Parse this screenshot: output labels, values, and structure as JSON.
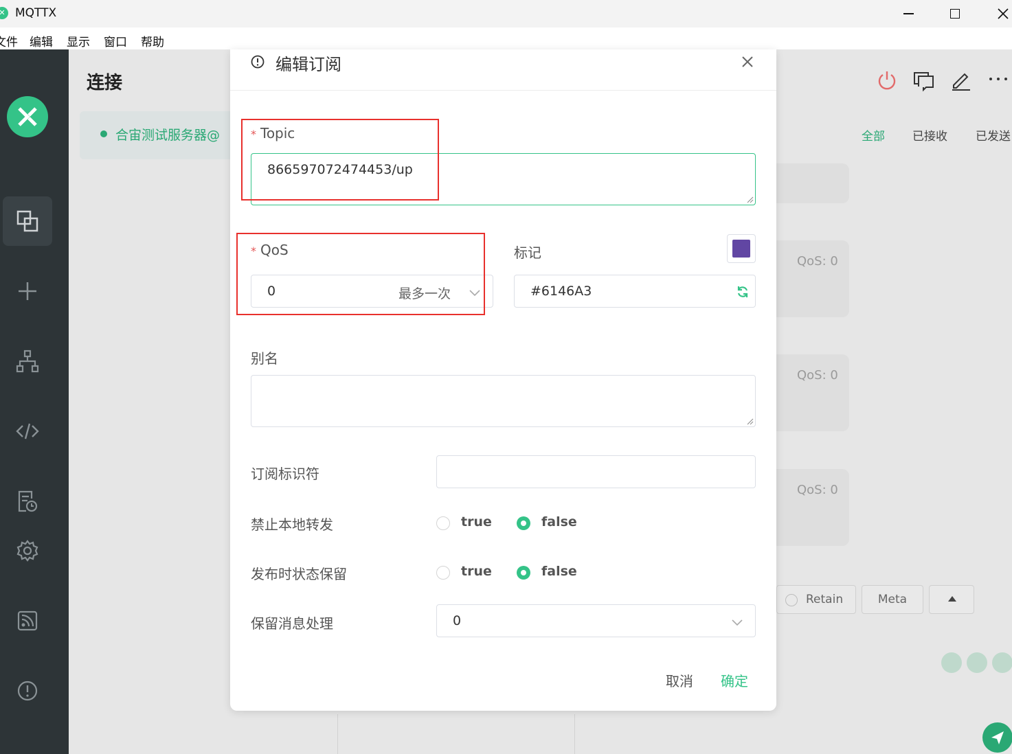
{
  "window": {
    "title": "MQTTX",
    "logo_glyph": "✕"
  },
  "menu": {
    "items": [
      "文件",
      "编辑",
      "显示",
      "窗口",
      "帮助"
    ]
  },
  "sidebar": {
    "icons": [
      "mqttx-logo-icon",
      "connections-icon",
      "add-icon",
      "topology-icon",
      "script-icon",
      "log-icon",
      "settings-icon",
      "subscribe-feed-icon",
      "about-icon"
    ]
  },
  "background": {
    "page_title": "连接",
    "connection_name": "合宙测试服务器@",
    "tabs": [
      "全部",
      "已接收",
      "已发送"
    ],
    "messages_qos": [
      "QoS: 0",
      "QoS: 0",
      "QoS: 0"
    ],
    "retain_label": "Retain",
    "meta_label": "Meta"
  },
  "dialog": {
    "title": "编辑订阅",
    "topic": {
      "label": "Topic",
      "required_mark": "*",
      "value": "866597072474453/up"
    },
    "qos": {
      "label": "QoS",
      "required_mark": "*",
      "value": "0",
      "value_desc": "最多一次"
    },
    "mark": {
      "label": "标记",
      "color": "#6146A3",
      "value": "#6146A3"
    },
    "alias": {
      "label": "别名",
      "value": ""
    },
    "sub_identifier": {
      "label": "订阅标识符",
      "value": ""
    },
    "no_local": {
      "label": "禁止本地转发",
      "options": [
        "true",
        "false"
      ],
      "selected": "false"
    },
    "retain_as_published": {
      "label": "发布时状态保留",
      "options": [
        "true",
        "false"
      ],
      "selected": "false"
    },
    "retain_handling": {
      "label": "保留消息处理",
      "value": "0"
    },
    "cancel_label": "取消",
    "confirm_label": "确定"
  },
  "colors": {
    "accent": "#34c388",
    "annotation": "#e8302c",
    "sidebar_bg": "#2d3437"
  }
}
